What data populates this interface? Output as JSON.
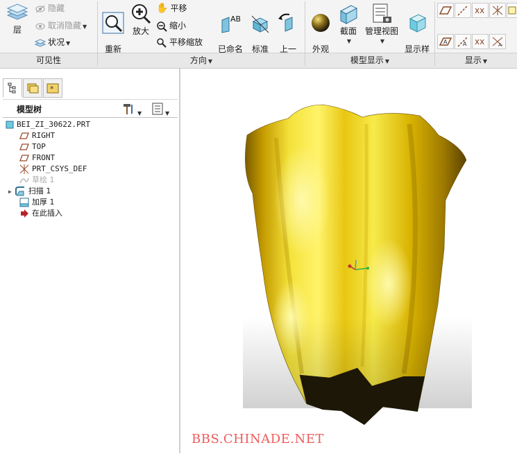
{
  "ribbon": {
    "visibility": {
      "layer_label": "层",
      "hide_label": "隐藏",
      "unhide_label": "取消隐藏",
      "status_label": "状况",
      "group_label": "可见性"
    },
    "orientation": {
      "refit_label": "重新\n调整",
      "zoom_in_label": "放大",
      "pan_label": "平移",
      "zoom_out_label": "缩小",
      "pan_zoom_label": "平移缩放",
      "named_views_label": "已命名\n视图",
      "standard_orientation_label": "标准\n方向",
      "previous_label": "上一\n个",
      "group_label": "方向"
    },
    "model_display": {
      "appearance_label": "外观\n库",
      "section_label": "截面",
      "manage_views_label": "管理视图",
      "display_style_label": "显示样\n式",
      "group_label": "模型显示"
    },
    "show": {
      "group_label": "显示"
    }
  },
  "panel": {
    "tree_title": "模型树",
    "nodes": [
      {
        "label": "BEI_ZI_30622.PRT",
        "icon": "part-icon"
      },
      {
        "label": "RIGHT",
        "icon": "datum-plane-icon"
      },
      {
        "label": "TOP",
        "icon": "datum-plane-icon"
      },
      {
        "label": "FRONT",
        "icon": "datum-plane-icon"
      },
      {
        "label": "PRT_CSYS_DEF",
        "icon": "csys-icon"
      },
      {
        "label": "草绘 1",
        "icon": "sketch-icon",
        "dimmed": true
      },
      {
        "label": "扫描 1",
        "icon": "sweep-icon",
        "expandable": true
      },
      {
        "label": "加厚 1",
        "icon": "thicken-icon"
      },
      {
        "label": "在此插入",
        "icon": "insert-here-icon"
      }
    ]
  },
  "viewport": {
    "watermark": "BBS.CHINADE.NET",
    "model_color": "#e8c20a"
  }
}
